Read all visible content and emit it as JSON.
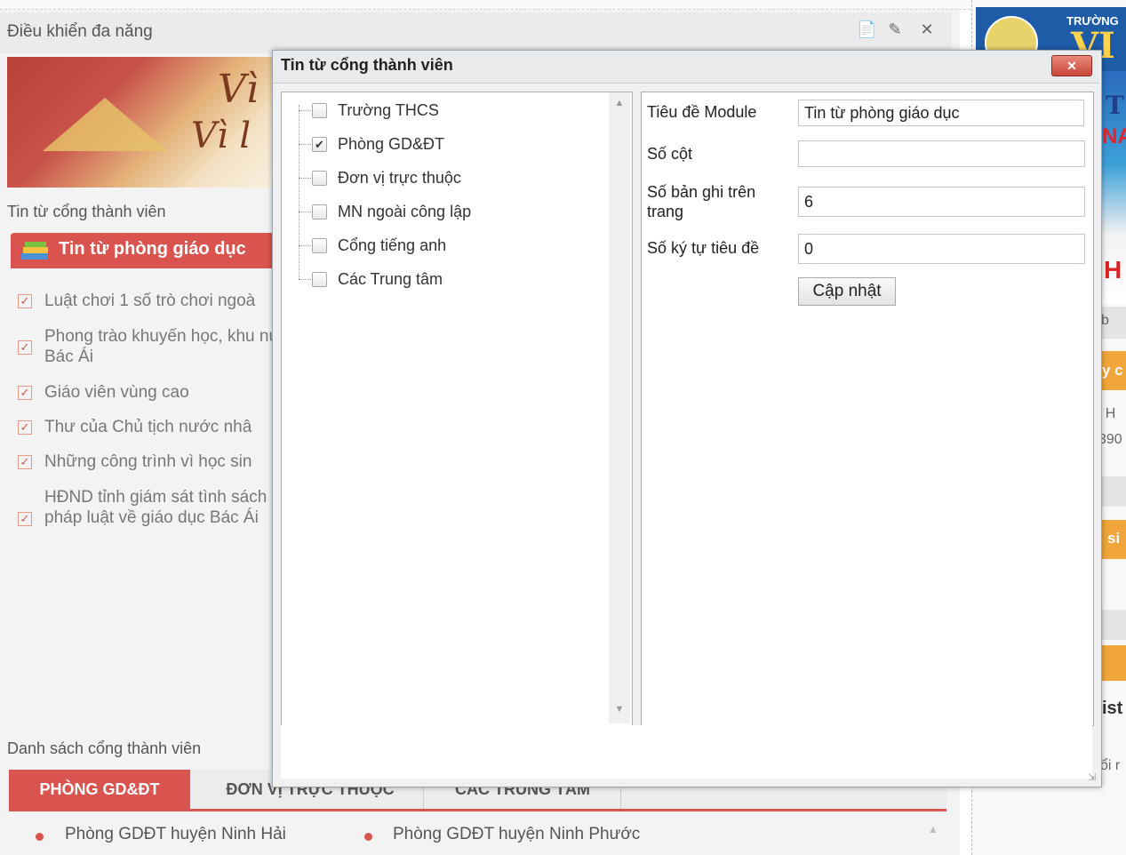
{
  "left_panel": {
    "title": "Điều khiển đa năng",
    "banner_text_1": "Vì",
    "banner_text_2": "Vì l",
    "members_label": "Tin từ cổng thành viên",
    "news_tab_label": "Tin từ phòng giáo dục",
    "news_items": [
      "Luật chơi 1 số trò chơi ngoà",
      "Phong trào khuyến học, khu núi Bác Ái",
      "Giáo viên vùng cao",
      "Thư của Chủ tịch nước nhâ",
      "Những công trình vì học sin",
      "HĐND tỉnh giám sát tình sách pháp luật về giáo dục Bác Ái"
    ],
    "list_label": "Danh sách cổng thành viên",
    "tabs": [
      "PHÒNG GD&ĐT",
      "ĐƠN VỊ TRỰC THUỘC",
      "CÁC TRUNG TÂM"
    ],
    "links": [
      "Phòng GDĐT huyện Ninh Hải",
      "Phòng GDĐT huyện Ninh Phước"
    ]
  },
  "right_column": {
    "banner_small": "TRƯỜNG",
    "banner_big": "VI",
    "frag_T": "T",
    "frag_NA": "NA",
    "frag_H": "H",
    "frag_b": "b",
    "frag_yc": "y c",
    "frag_H2": ") H",
    "frag_390": "390",
    "frag_si": "si",
    "frag_ist": "ist",
    "frag_oi": "ổi r"
  },
  "dialog": {
    "title": "Tin từ cổng thành viên",
    "close_label": "✕",
    "tree": [
      {
        "label": "Trường THCS",
        "checked": false
      },
      {
        "label": "Phòng GD&ĐT",
        "checked": true
      },
      {
        "label": "Đơn vị trực thuộc",
        "checked": false
      },
      {
        "label": "MN ngoài công lập",
        "checked": false
      },
      {
        "label": "Cổng tiếng anh",
        "checked": false
      },
      {
        "label": "Các Trung tâm",
        "checked": false
      }
    ],
    "form": {
      "module_title_label": "Tiêu đề Module",
      "module_title_value": "Tin từ phòng giáo dục",
      "columns_label": "Số cột",
      "columns_value": "",
      "records_label_1": "Số bản ghi trên",
      "records_label_2": "trang",
      "records_value": "6",
      "title_chars_label": "Số ký tự tiêu đề",
      "title_chars_value": "0",
      "update_button": "Cập nhật"
    }
  },
  "colors": {
    "accent": "#d9534f",
    "orange": "#f0a63a",
    "blue": "#1e5ca8"
  }
}
